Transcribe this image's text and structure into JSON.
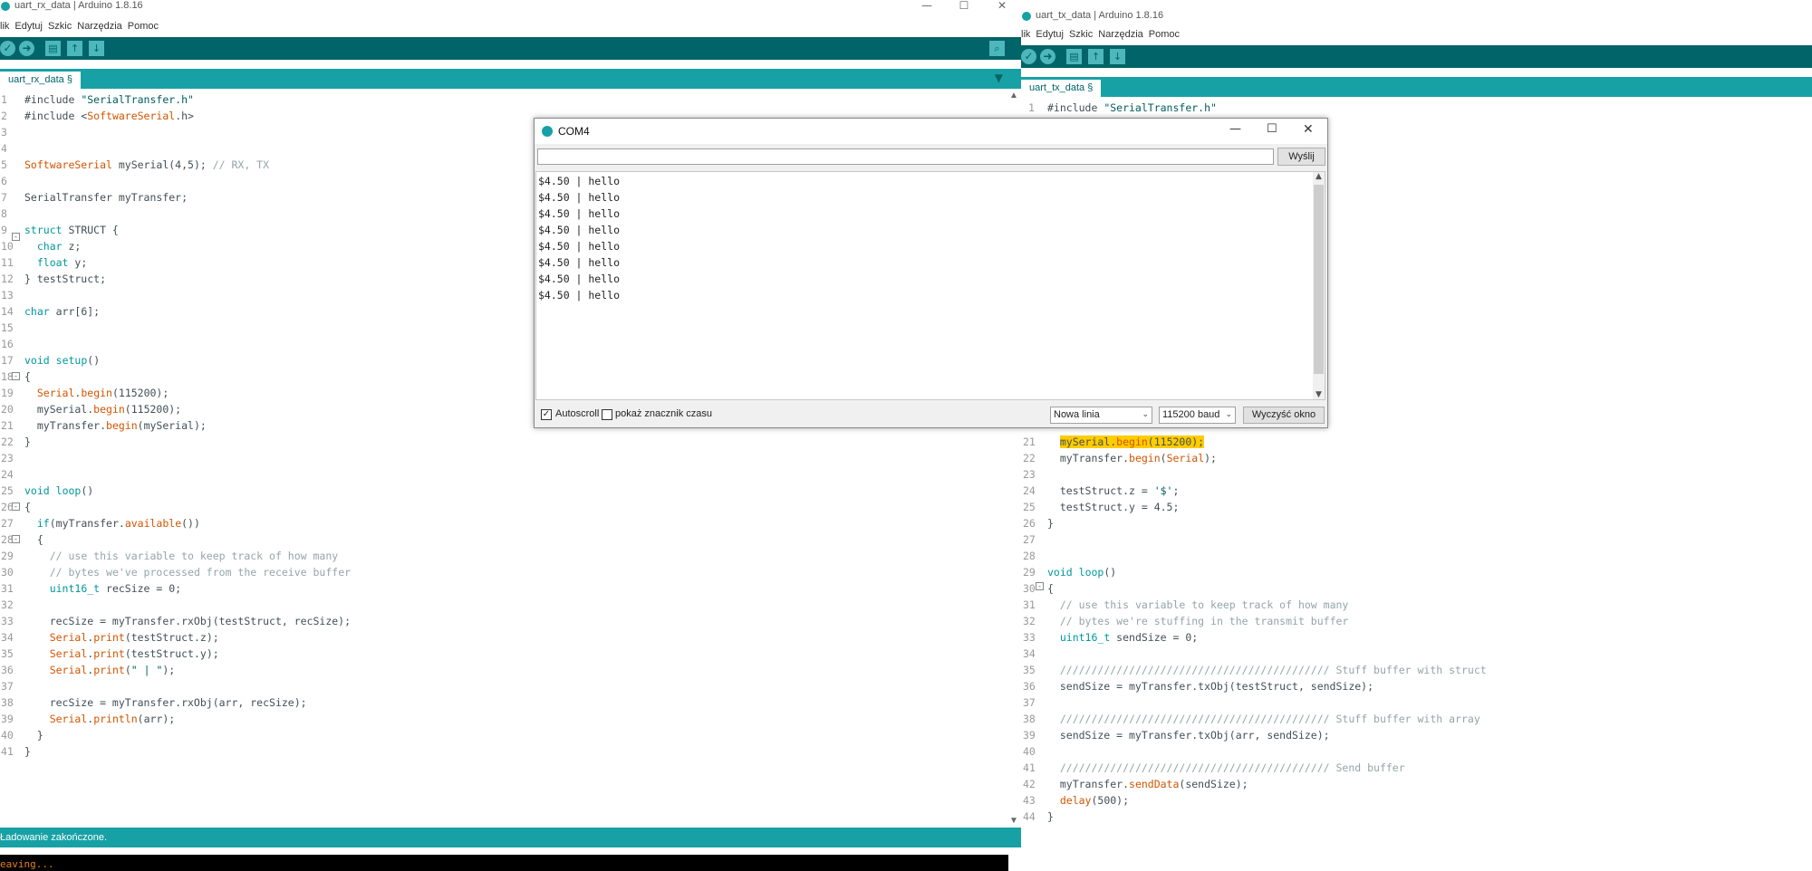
{
  "left_window": {
    "title": "uart_rx_data | Arduino 1.8.16",
    "menu": [
      "lik",
      "Edytuj",
      "Szkic",
      "Narzędzia",
      "Pomoc"
    ],
    "tab": "uart_rx_data §",
    "status": "Ładowanie zakończone.",
    "console": "eaving...",
    "code": [
      {
        "n": "1",
        "html": "#include <span class=\"st\">\"SerialTransfer.h\"</span>"
      },
      {
        "n": "2",
        "html": "#include &lt;<span class=\"fn\">SoftwareSerial</span>.h&gt;"
      },
      {
        "n": "3",
        "html": ""
      },
      {
        "n": "4",
        "html": ""
      },
      {
        "n": "5",
        "html": "<span class=\"fn\">SoftwareSerial</span> mySerial(4,5); <span class=\"cm\">// RX, TX</span>"
      },
      {
        "n": "6",
        "html": ""
      },
      {
        "n": "7",
        "html": "SerialTransfer myTransfer;"
      },
      {
        "n": "8",
        "html": ""
      },
      {
        "n": "9",
        "html": "<span class=\"kw\">struct</span> STRUCT {"
      },
      {
        "n": "10",
        "html": "  <span class=\"kw\">char</span> z;"
      },
      {
        "n": "11",
        "html": "  <span class=\"kw\">float</span> y;"
      },
      {
        "n": "12",
        "html": "} testStruct;"
      },
      {
        "n": "13",
        "html": ""
      },
      {
        "n": "14",
        "html": "<span class=\"kw\">char</span> arr[6];"
      },
      {
        "n": "15",
        "html": ""
      },
      {
        "n": "16",
        "html": ""
      },
      {
        "n": "17",
        "html": "<span class=\"kw\">void</span> <span class=\"kw\">setup</span>()"
      },
      {
        "n": "18",
        "html": "{"
      },
      {
        "n": "19",
        "html": "  <span class=\"fn\">Serial</span>.<span class=\"fn\">begin</span>(115200);"
      },
      {
        "n": "20",
        "html": "  mySerial.<span class=\"fn\">begin</span>(115200);"
      },
      {
        "n": "21",
        "html": "  myTransfer.<span class=\"fn\">begin</span>(mySerial);"
      },
      {
        "n": "22",
        "html": "}"
      },
      {
        "n": "23",
        "html": ""
      },
      {
        "n": "24",
        "html": ""
      },
      {
        "n": "25",
        "html": "<span class=\"kw\">void</span> <span class=\"kw\">loop</span>()"
      },
      {
        "n": "26",
        "html": "{"
      },
      {
        "n": "27",
        "html": "  <span class=\"kw\">if</span>(myTransfer.<span class=\"fn\">available</span>())"
      },
      {
        "n": "28",
        "html": "  {"
      },
      {
        "n": "29",
        "html": "    <span class=\"cm\">// use this variable to keep track of how many</span>"
      },
      {
        "n": "30",
        "html": "    <span class=\"cm\">// bytes we've processed from the receive buffer</span>"
      },
      {
        "n": "31",
        "html": "    <span class=\"kw\">uint16_t</span> recSize = 0;"
      },
      {
        "n": "32",
        "html": ""
      },
      {
        "n": "33",
        "html": "    recSize = myTransfer.rxObj(testStruct, recSize);"
      },
      {
        "n": "34",
        "html": "    <span class=\"fn\">Serial</span>.<span class=\"fn\">print</span>(testStruct.z);"
      },
      {
        "n": "35",
        "html": "    <span class=\"fn\">Serial</span>.<span class=\"fn\">print</span>(testStruct.y);"
      },
      {
        "n": "36",
        "html": "    <span class=\"fn\">Serial</span>.<span class=\"fn\">print</span>(<span class=\"st\">\" | \"</span>);"
      },
      {
        "n": "37",
        "html": ""
      },
      {
        "n": "38",
        "html": "    recSize = myTransfer.rxObj(arr, recSize);"
      },
      {
        "n": "39",
        "html": "    <span class=\"fn\">Serial</span>.<span class=\"fn\">println</span>(arr);"
      },
      {
        "n": "40",
        "html": "  }"
      },
      {
        "n": "41",
        "html": "}"
      }
    ]
  },
  "right_window": {
    "title": "uart_tx_data | Arduino 1.8.16",
    "menu": [
      "lik",
      "Edytuj",
      "Szkic",
      "Narzędzia",
      "Pomoc"
    ],
    "tab": "uart_tx_data §",
    "code_top": [
      {
        "n": "1",
        "html": "#include <span class=\"st\">\"SerialTransfer.h\"</span>"
      }
    ],
    "code": [
      {
        "n": "21",
        "html": "  <span class=\"hl\">mySerial.<span class=\"fn\">begin</span>(115200);</span>"
      },
      {
        "n": "22",
        "html": "  myTransfer.<span class=\"fn\">begin</span>(<span class=\"fn\">Serial</span>);"
      },
      {
        "n": "23",
        "html": ""
      },
      {
        "n": "24",
        "html": "  testStruct.z = <span class=\"st\">'$'</span>;"
      },
      {
        "n": "25",
        "html": "  testStruct.y = 4.5;"
      },
      {
        "n": "26",
        "html": "}"
      },
      {
        "n": "27",
        "html": ""
      },
      {
        "n": "28",
        "html": ""
      },
      {
        "n": "29",
        "html": "<span class=\"kw\">void</span> <span class=\"kw\">loop</span>()"
      },
      {
        "n": "30",
        "html": "{"
      },
      {
        "n": "31",
        "html": "  <span class=\"cm\">// use this variable to keep track of how many</span>"
      },
      {
        "n": "32",
        "html": "  <span class=\"cm\">// bytes we're stuffing in the transmit buffer</span>"
      },
      {
        "n": "33",
        "html": "  <span class=\"kw\">uint16_t</span> sendSize = 0;"
      },
      {
        "n": "34",
        "html": ""
      },
      {
        "n": "35",
        "html": "  <span class=\"cm\">/////////////////////////////////////////// Stuff buffer with struct</span>"
      },
      {
        "n": "36",
        "html": "  sendSize = myTransfer.txObj(testStruct, sendSize);"
      },
      {
        "n": "37",
        "html": ""
      },
      {
        "n": "38",
        "html": "  <span class=\"cm\">/////////////////////////////////////////// Stuff buffer with array</span>"
      },
      {
        "n": "39",
        "html": "  sendSize = myTransfer.txObj(arr, sendSize);"
      },
      {
        "n": "40",
        "html": ""
      },
      {
        "n": "41",
        "html": "  <span class=\"cm\">/////////////////////////////////////////// Send buffer</span>"
      },
      {
        "n": "42",
        "html": "  myTransfer.<span class=\"fn\">sendData</span>(sendSize);"
      },
      {
        "n": "43",
        "html": "  <span class=\"fn\">delay</span>(500);"
      },
      {
        "n": "44",
        "html": "}"
      }
    ]
  },
  "serial_monitor": {
    "title": "COM4",
    "input_value": "",
    "send_label": "Wyślij",
    "output_lines": [
      "$4.50 | hello",
      "$4.50 | hello",
      "$4.50 | hello",
      "$4.50 | hello",
      "$4.50 | hello",
      "$4.50 | hello",
      "$4.50 | hello",
      "$4.50 | hello"
    ],
    "autoscroll_label": "Autoscroll",
    "autoscroll_checked": true,
    "timestamp_label": "pokaż znacznik czasu",
    "timestamp_checked": false,
    "line_ending": "Nowa linia",
    "baud": "115200 baud",
    "clear_label": "Wyczyść okno"
  },
  "colors": {
    "toolbar": "#006468",
    "tabbar": "#17a1a5",
    "keyword": "#00979c",
    "function": "#d35400",
    "highlight": "#ffcc00"
  }
}
